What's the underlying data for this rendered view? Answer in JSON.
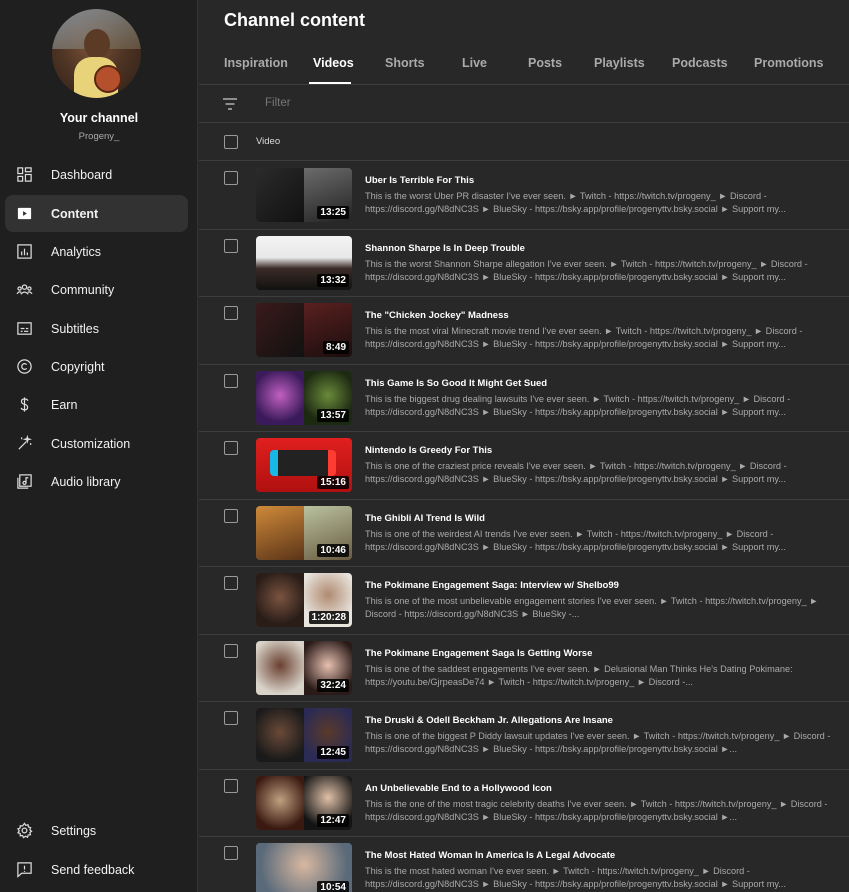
{
  "sidebar": {
    "channel_label": "Your channel",
    "channel_handle": "Progeny_",
    "items": [
      {
        "label": "Dashboard",
        "icon": "dashboard-icon"
      },
      {
        "label": "Content",
        "icon": "content-icon",
        "active": true
      },
      {
        "label": "Analytics",
        "icon": "analytics-icon"
      },
      {
        "label": "Community",
        "icon": "community-icon"
      },
      {
        "label": "Subtitles",
        "icon": "subtitles-icon"
      },
      {
        "label": "Copyright",
        "icon": "copyright-icon"
      },
      {
        "label": "Earn",
        "icon": "dollar-icon"
      },
      {
        "label": "Customization",
        "icon": "magic-wand-icon"
      },
      {
        "label": "Audio library",
        "icon": "audio-library-icon"
      }
    ],
    "bottom": [
      {
        "label": "Settings",
        "icon": "gear-icon"
      },
      {
        "label": "Send feedback",
        "icon": "feedback-icon"
      }
    ]
  },
  "main": {
    "title": "Channel content",
    "tabs": [
      "Inspiration",
      "Videos",
      "Shorts",
      "Live",
      "Posts",
      "Playlists",
      "Podcasts",
      "Promotions"
    ],
    "active_tab": "Videos",
    "filter_placeholder": "Filter",
    "column_header": "Video",
    "videos": [
      {
        "title": "Uber Is Terrible For This",
        "duration": "13:25",
        "desc": "This is the worst Uber PR disaster I've ever seen. ► Twitch - https://twitch.tv/progeny_ ► Discord - https://discord.gg/N8dNC3S ► BlueSky - https://bsky.app/profile/progenyttv.bsky.social ► Support my..."
      },
      {
        "title": "Shannon Sharpe Is In Deep Trouble",
        "duration": "13:32",
        "desc": "This is the worst Shannon Sharpe allegation I've ever seen. ► Twitch - https://twitch.tv/progeny_ ► Discord - https://discord.gg/N8dNC3S ► BlueSky - https://bsky.app/profile/progenyttv.bsky.social ► Support my..."
      },
      {
        "title": "The \"Chicken Jockey\" Madness",
        "duration": "8:49",
        "desc": "This is the most viral Minecraft movie trend I've ever seen. ► Twitch - https://twitch.tv/progeny_ ► Discord - https://discord.gg/N8dNC3S ► BlueSky - https://bsky.app/profile/progenyttv.bsky.social ► Support my..."
      },
      {
        "title": "This Game Is So Good It Might Get Sued",
        "duration": "13:57",
        "desc": "This is the biggest drug dealing lawsuits I've ever seen. ► Twitch - https://twitch.tv/progeny_ ► Discord - https://discord.gg/N8dNC3S ► BlueSky - https://bsky.app/profile/progenyttv.bsky.social ► Support my..."
      },
      {
        "title": "Nintendo Is Greedy For This",
        "duration": "15:16",
        "desc": "This is one of the craziest price reveals I've ever seen. ► Twitch - https://twitch.tv/progeny_ ► Discord - https://discord.gg/N8dNC3S ► BlueSky - https://bsky.app/profile/progenyttv.bsky.social ► Support my..."
      },
      {
        "title": "The Ghibli AI Trend Is Wild",
        "duration": "10:46",
        "desc": "This is one of the weirdest AI trends I've ever seen. ► Twitch - https://twitch.tv/progeny_ ► Discord - https://discord.gg/N8dNC3S ► BlueSky - https://bsky.app/profile/progenyttv.bsky.social ► Support my..."
      },
      {
        "title": "The Pokimane Engagement Saga: Interview w/ Shelbo99",
        "duration": "1:20:28",
        "desc": "This is one of the most unbelievable engagement stories I've ever seen. ► Twitch - https://twitch.tv/progeny_ ► Discord - https://discord.gg/N8dNC3S ► BlueSky -..."
      },
      {
        "title": "The Pokimane Engagement Saga Is Getting Worse",
        "duration": "32:24",
        "desc": "This is one of the saddest engagements I've ever seen. ► Delusional Man Thinks He's Dating Pokimane: https://youtu.be/GjrpeasDe74 ► Twitch - https://twitch.tv/progeny_ ► Discord -..."
      },
      {
        "title": "The Druski & Odell Beckham Jr. Allegations Are Insane",
        "duration": "12:45",
        "desc": "This is one of the biggest P Diddy lawsuit updates I've ever seen. ► Twitch - https://twitch.tv/progeny_ ► Discord - https://discord.gg/N8dNC3S ► BlueSky - https://bsky.app/profile/progenyttv.bsky.social ►..."
      },
      {
        "title": "An Unbelievable End to a Hollywood Icon",
        "duration": "12:47",
        "desc": "This is the one of the most tragic celebrity deaths I've ever seen. ► Twitch - https://twitch.tv/progeny_ ► Discord - https://discord.gg/N8dNC3S ► BlueSky - https://bsky.app/profile/progenyttv.bsky.social ►..."
      },
      {
        "title": "The Most Hated Woman In America Is A Legal Advocate",
        "duration": "10:54",
        "desc": "This is the most hated woman I've ever seen. ► Twitch - https://twitch.tv/progeny_ ► Discord - https://discord.gg/N8dNC3S ► BlueSky - https://bsky.app/profile/progenyttv.bsky.social ► Support my..."
      }
    ]
  },
  "colors": {
    "sidebar_bg": "#1f1f1f",
    "main_bg": "#282828",
    "active_item_bg": "#323232",
    "text_primary": "#ffffff",
    "text_secondary": "#aaaaaa"
  }
}
